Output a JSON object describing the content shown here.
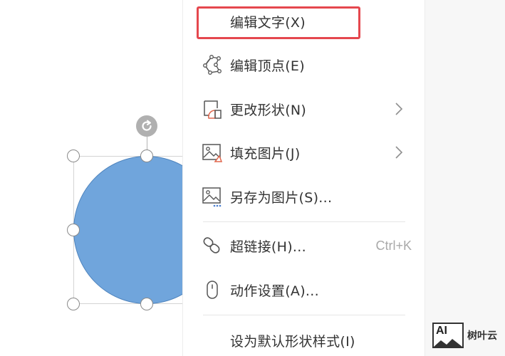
{
  "menu": {
    "items": [
      {
        "label": "编辑文字(X)",
        "icon": "none"
      },
      {
        "label": "编辑顶点(E)",
        "icon": "edit-points-icon"
      },
      {
        "label": "更改形状(N)",
        "icon": "change-shape-icon",
        "submenu": true
      },
      {
        "label": "填充图片(J)",
        "icon": "fill-picture-icon",
        "submenu": true
      },
      {
        "label": "另存为图片(S)...",
        "icon": "save-as-picture-icon"
      },
      {
        "label": "超链接(H)...",
        "icon": "hyperlink-icon",
        "shortcut": "Ctrl+K"
      },
      {
        "label": "动作设置(A)...",
        "icon": "mouse-icon"
      },
      {
        "label": "设为默认形状样式(I)",
        "icon": "none"
      }
    ]
  },
  "shape": {
    "fill_color": "#70a5dc",
    "border_color": "#4f84bd"
  },
  "highlight_color": "#e5474e",
  "watermark": {
    "logo": "AI",
    "text": "树叶云"
  }
}
